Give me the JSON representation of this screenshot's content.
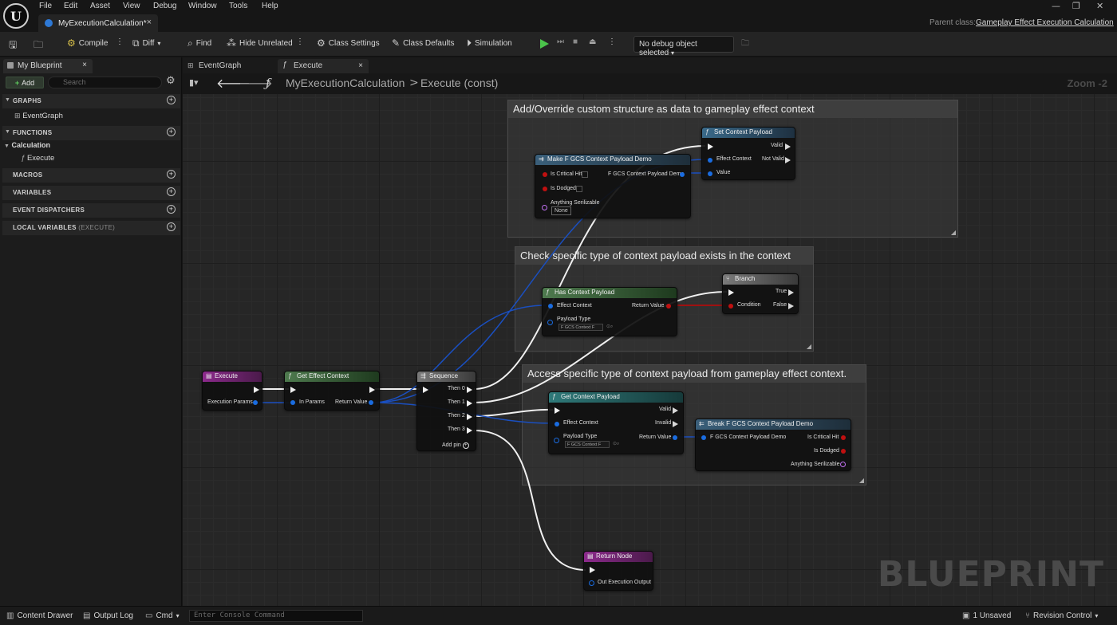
{
  "menubar": {
    "items": [
      "File",
      "Edit",
      "Asset",
      "View",
      "Debug",
      "Window",
      "Tools",
      "Help"
    ],
    "logo": "U"
  },
  "doc_tab": {
    "title": "MyExecutionCalculation*",
    "close": "×"
  },
  "parent_class": {
    "label": "Parent class:",
    "value": "Gameplay Effect Execution Calculation"
  },
  "window_controls": {
    "minimize": "—",
    "restore": "❐",
    "close": "✕"
  },
  "toolbar": {
    "compile": "Compile",
    "diff": "Diff",
    "find": "Find",
    "hide_unrelated": "Hide Unrelated",
    "class_settings": "Class Settings",
    "class_defaults": "Class Defaults",
    "simulation": "Simulation",
    "debug_select": "No debug object selected"
  },
  "left_panel": {
    "tab": "My Blueprint",
    "add": "Add",
    "search_placeholder": "Search",
    "sections": {
      "graphs": "GRAPHS",
      "functions": "FUNCTIONS",
      "macros": "MACROS",
      "variables": "VARIABLES",
      "event_dispatchers": "EVENT DISPATCHERS",
      "local_variables": "LOCAL VARIABLES",
      "local_variables_suffix": "(EXECUTE)"
    },
    "graph_items": [
      "EventGraph"
    ],
    "function_category": "Calculation",
    "function_items": [
      "Execute"
    ]
  },
  "graph": {
    "tabs": [
      "EventGraph",
      "Execute"
    ],
    "breadcrumb": [
      "MyExecutionCalculation",
      "Execute (const)"
    ],
    "breadcrumb_sep": ">",
    "zoom": "Zoom -2",
    "watermark": "BLUEPRINT",
    "comments": {
      "c1": "Add/Override custom structure as data to gameplay effect context",
      "c2": "Check specific type of context payload exists in the context",
      "c3": "Access specific type of  context payload  from gameplay effect context."
    },
    "nodes": {
      "execute": {
        "title": "Execute",
        "pin_params": "Execution Params"
      },
      "get_effect_context": {
        "title": "Get Effect Context",
        "pin_in": "In Params",
        "pin_ret": "Return Value"
      },
      "sequence": {
        "title": "Sequence",
        "then0": "Then 0",
        "then1": "Then 1",
        "then2": "Then 2",
        "then3": "Then 3",
        "add_pin": "Add pin"
      },
      "make_payload": {
        "title": "Make F GCS Context Payload Demo",
        "is_critical": "Is Critical Hit",
        "is_dodged": "Is Dodged",
        "anything": "Anything Serilizable",
        "none": "None",
        "out": "F GCS Context Payload Demo"
      },
      "set_payload": {
        "title": "Set Context Payload",
        "valid": "Valid",
        "not_valid": "Not Valid",
        "effect_context": "Effect Context",
        "value": "Value"
      },
      "has_payload": {
        "title": "Has Context Payload",
        "effect_context": "Effect Context",
        "payload_type": "Payload Type",
        "combo": "F GCS Context F",
        "ret": "Return Value"
      },
      "branch": {
        "title": "Branch",
        "true": "True",
        "false": "False",
        "condition": "Condition"
      },
      "get_payload": {
        "title": "Get Context Payload",
        "valid": "Valid",
        "invalid": "Invalid",
        "effect_context": "Effect Context",
        "payload_type": "Payload Type",
        "combo": "F GCS Context F",
        "ret": "Return Value"
      },
      "break_payload": {
        "title": "Break F GCS Context Payload Demo",
        "in": "F GCS Context Payload Demo",
        "is_critical": "Is Critical Hit",
        "is_dodged": "Is Dodged",
        "anything": "Anything Serilizable"
      },
      "return_node": {
        "title": "Return Node",
        "out": "Out Execution Output"
      }
    }
  },
  "bottombar": {
    "content_drawer": "Content Drawer",
    "output_log": "Output Log",
    "cmd": "Cmd",
    "console_placeholder": "Enter Console Command",
    "unsaved": "1 Unsaved",
    "revision_control": "Revision Control"
  },
  "colors": {
    "exec_wire": "#f0f0f0",
    "struct_wire": "#1a4fc0",
    "bool_wire": "#a01010",
    "function_header": "#3a5f7a",
    "pure_header": "#3e6e3e",
    "event_header": "#8a2a8a",
    "sequence_header": "#5a5a5a",
    "accent_play": "#4bc44b"
  }
}
